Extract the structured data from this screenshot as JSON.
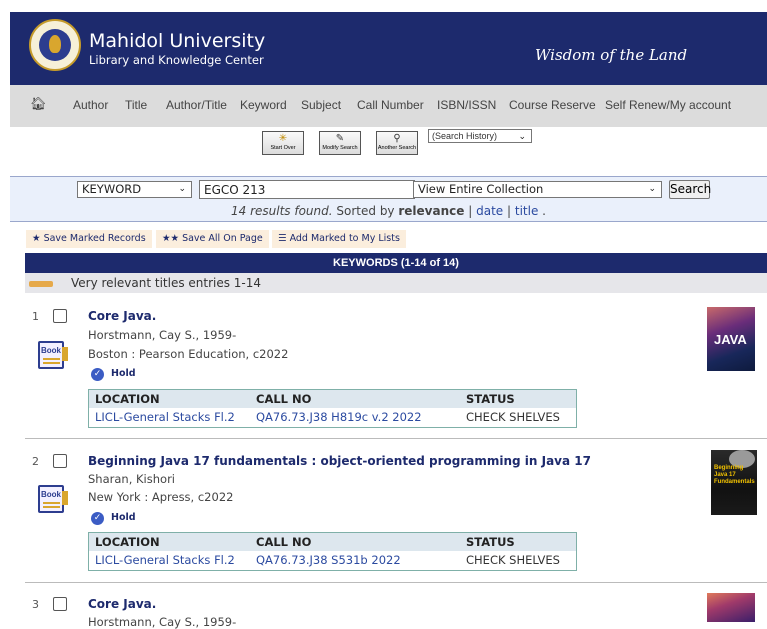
{
  "header": {
    "university": "Mahidol University",
    "subtitle": "Library and Knowledge Center",
    "motto": "Wisdom of the Land"
  },
  "nav": {
    "home_icon": "home-icon",
    "items": [
      "Author",
      "Title",
      "Author/Title",
      "Keyword",
      "Subject",
      "Call Number",
      "ISBN/ISSN",
      "Course Reserve",
      "Self Renew/My account"
    ]
  },
  "search_buttons": {
    "start_over": "Start Over",
    "modify_search": "Modify Search",
    "another_search": "Another Search",
    "history": "(Search History)"
  },
  "search": {
    "type": "KEYWORD",
    "query": "EGCO 213",
    "scope": "View Entire Collection",
    "button": "Search",
    "results_found": "14 results found.",
    "sorted_by": "Sorted by",
    "sort_current": "relevance",
    "sort_date": "date",
    "sort_title": "title",
    "sep": "|"
  },
  "actions": {
    "save_marked": "Save Marked Records",
    "save_all": "Save All On Page",
    "add_marked": "Add Marked to My Lists"
  },
  "results_header": "KEYWORDS (1-14 of 14)",
  "relevance_text": "Very relevant titles entries 1-14",
  "table_headers": {
    "location": "LOCATION",
    "call_no": "CALL NO",
    "status": "STATUS"
  },
  "hold_label": "Hold",
  "book_label": "Book",
  "records": [
    {
      "num": "1",
      "title": "Core Java.",
      "author": "Horstmann, Cay S., 1959-",
      "publisher": "Boston : Pearson Education, c2022",
      "location": "LICL-General Stacks Fl.2",
      "call_no": "QA76.73.J38 H819c v.2 2022",
      "status": "CHECK SHELVES",
      "cover_text": "JAVA"
    },
    {
      "num": "2",
      "title": "Beginning Java 17 fundamentals : object-oriented programming in Java 17",
      "author": "Sharan, Kishori",
      "publisher": "New York : Apress, c2022",
      "location": "LICL-General Stacks Fl.2",
      "call_no": "QA76.73.J38 S531b 2022",
      "status": "CHECK SHELVES",
      "cover_text": "Beginning Java 17 Fundamentals"
    },
    {
      "num": "3",
      "title": "Core Java.",
      "author": "Horstmann, Cay S., 1959-"
    }
  ]
}
